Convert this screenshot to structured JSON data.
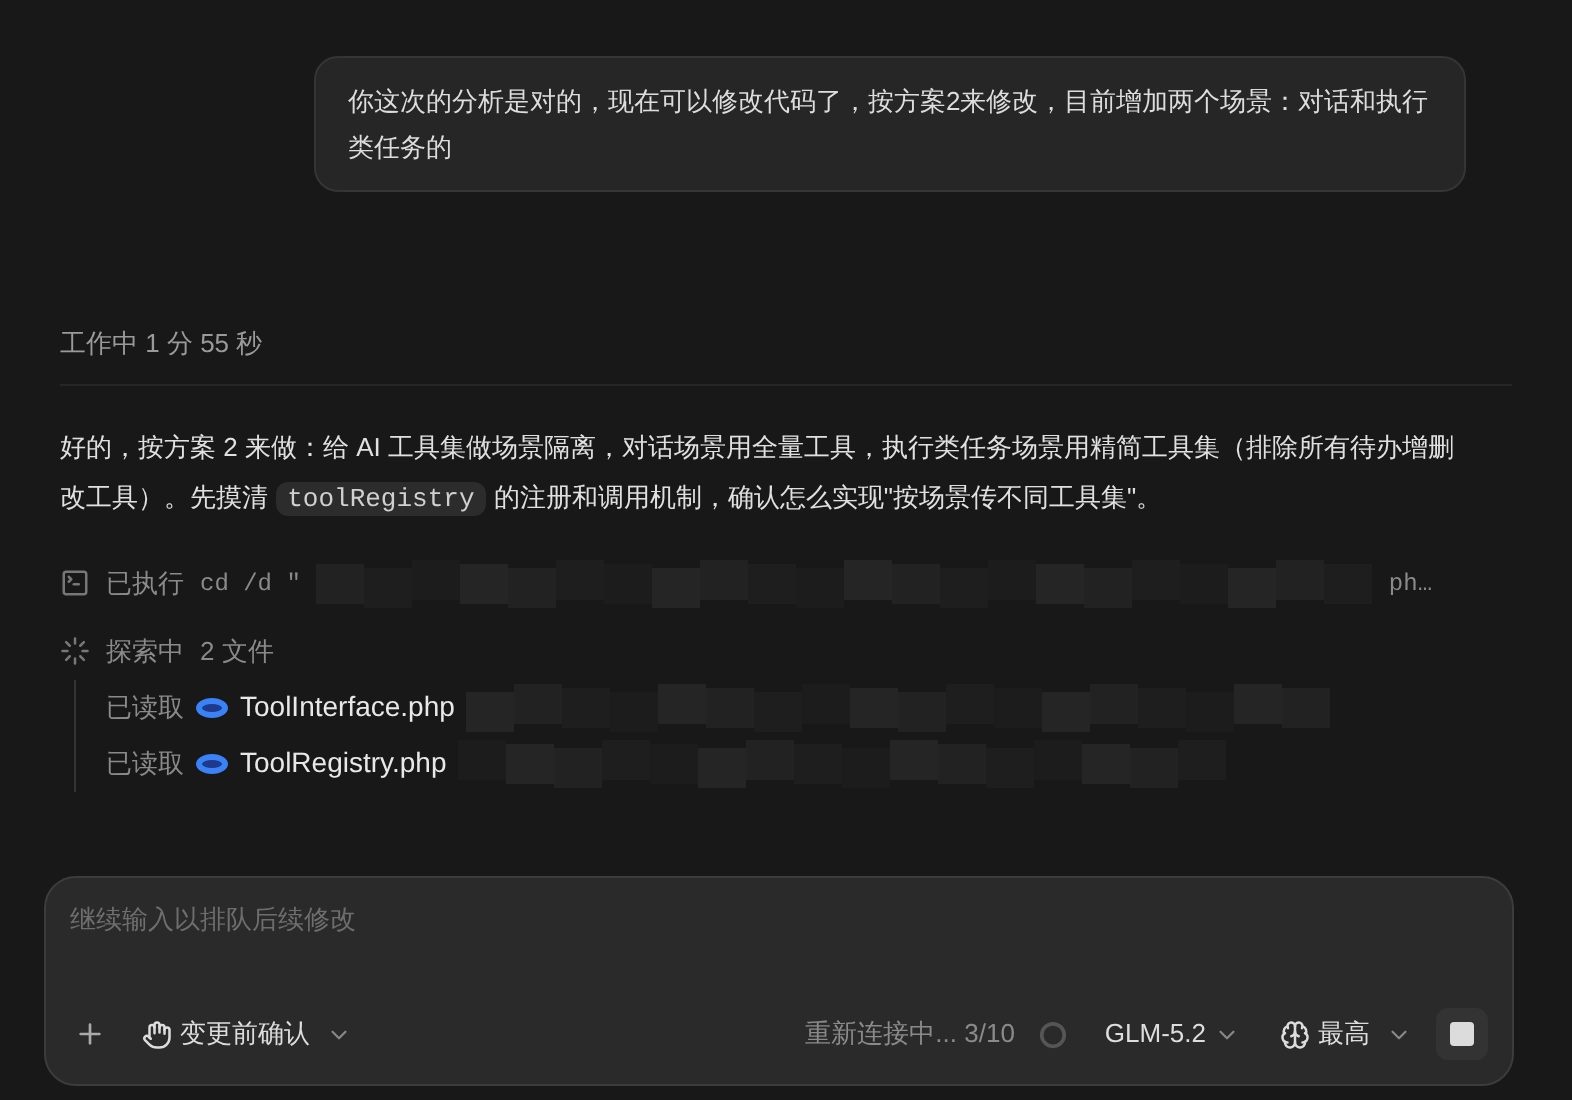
{
  "user_message": {
    "text": "你这次的分析是对的，现在可以修改代码了，按方案2来修改，目前增加两个场景：对话和执行类任务的"
  },
  "status": {
    "text": "工作中 1 分 55 秒"
  },
  "assistant_message": {
    "segments": [
      {
        "kind": "text",
        "text": "好的，按方案 2 来做：给 AI 工具集做场景隔离，对话场景用全量工具，执行类任务场景用精简工具集（排除所有待办增删改工具）。先摸清 "
      },
      {
        "kind": "code",
        "text": "toolRegistry"
      },
      {
        "kind": "text",
        "text": " 的注册和调用机制，确认怎么实现\"按场景传不同工具集\"。"
      }
    ]
  },
  "command": {
    "label": "已执行",
    "text_start": "cd /d \"",
    "text_end": "ph…"
  },
  "explore": {
    "label": "探索中",
    "count": "2 文件",
    "items": [
      {
        "action": "已读取",
        "file": "ToolInterface.php"
      },
      {
        "action": "已读取",
        "file": "ToolRegistry.php"
      }
    ]
  },
  "composer": {
    "placeholder": "继续输入以排队后续修改",
    "mode": "变更前确认",
    "reconnect": "重新连接中... 3/10",
    "model": "GLM-5.2",
    "effort": "最高"
  }
}
